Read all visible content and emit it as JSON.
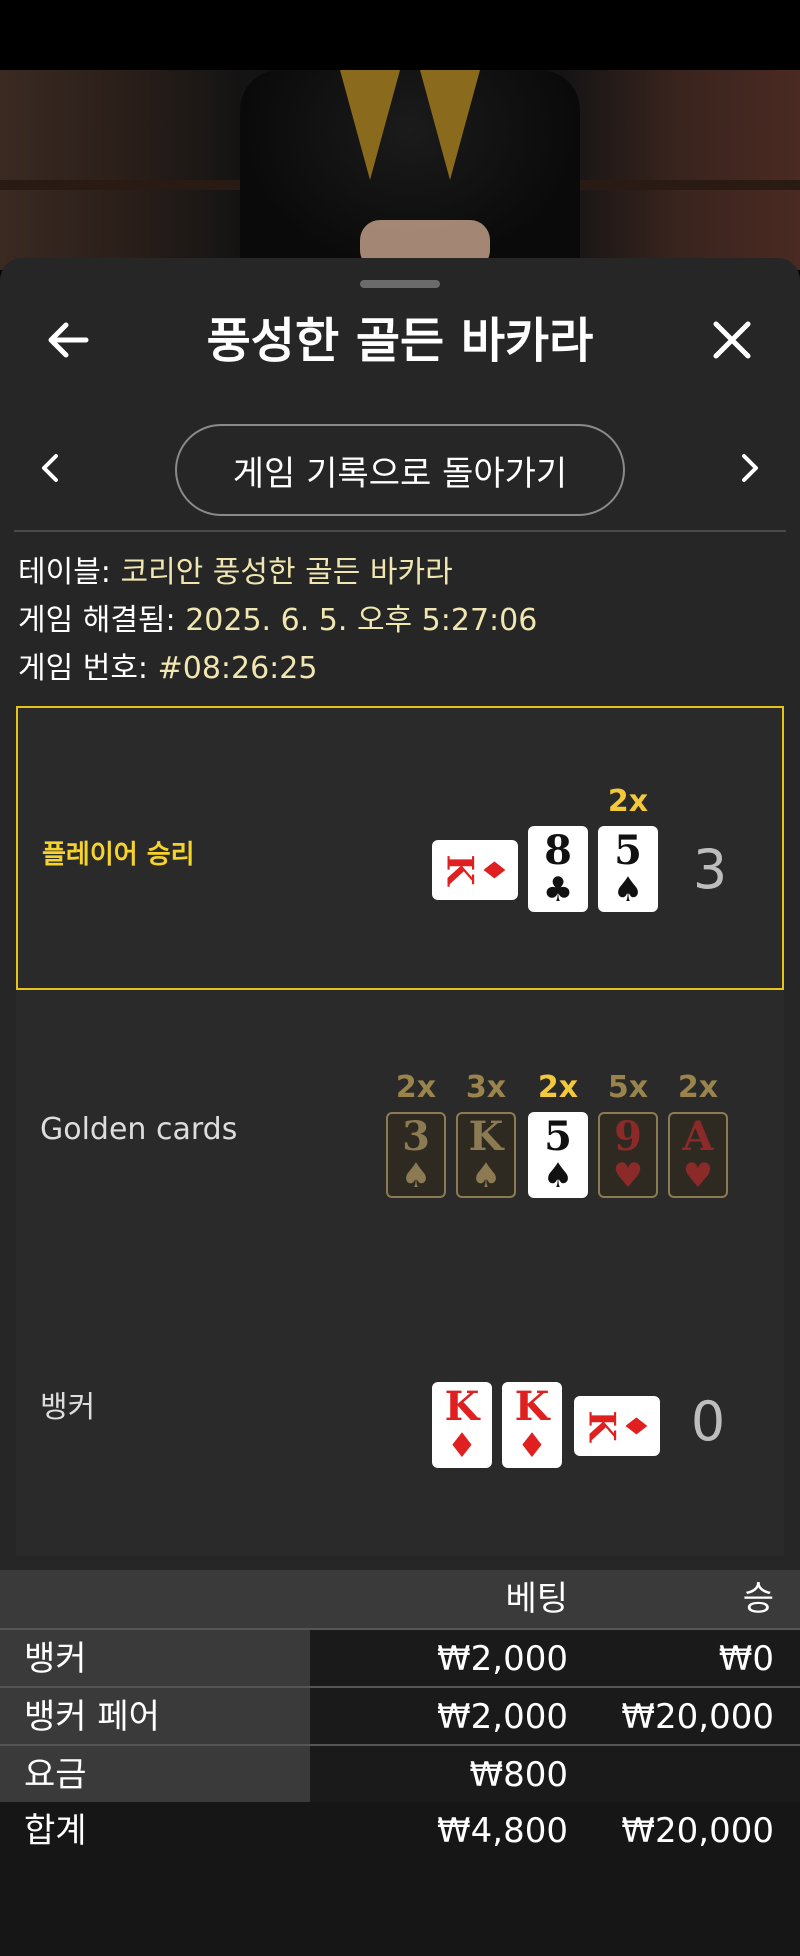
{
  "header": {
    "title": "풍성한 골든 바카라",
    "back_history": "게임 기록으로 돌아가기"
  },
  "meta": {
    "table_key": "테이블:",
    "table_value": "코리안 풍성한 골든 바카라",
    "resolved_key": "게임 해결됨:",
    "resolved_value": "2025. 6. 5. 오후 5:27:06",
    "number_key": "게임 번호:",
    "number_value": "#08:26:25"
  },
  "player": {
    "label": "플레이어 승리",
    "score": "3",
    "cards": [
      {
        "rank": "K",
        "suit": "♦",
        "color": "red",
        "sideways": true
      },
      {
        "rank": "8",
        "suit": "♣",
        "color": "black"
      },
      {
        "rank": "5",
        "suit": "♠",
        "color": "black",
        "multiplier": "2x"
      }
    ]
  },
  "golden": {
    "label": "Golden cards",
    "cards": [
      {
        "rank": "3",
        "suit": "♠",
        "color": "black",
        "multiplier": "2x",
        "active": false
      },
      {
        "rank": "K",
        "suit": "♠",
        "color": "black",
        "multiplier": "3x",
        "active": false
      },
      {
        "rank": "5",
        "suit": "♠",
        "color": "black",
        "multiplier": "2x",
        "active": true
      },
      {
        "rank": "9",
        "suit": "♥",
        "color": "red",
        "multiplier": "5x",
        "active": false
      },
      {
        "rank": "A",
        "suit": "♥",
        "color": "red",
        "multiplier": "2x",
        "active": false
      }
    ]
  },
  "banker": {
    "label": "뱅커",
    "score": "0",
    "cards": [
      {
        "rank": "K",
        "suit": "♦",
        "color": "red"
      },
      {
        "rank": "K",
        "suit": "♦",
        "color": "red"
      },
      {
        "rank": "K",
        "suit": "♦",
        "color": "red",
        "sideways": true
      }
    ]
  },
  "bets": {
    "col_bet": "베팅",
    "col_win": "승",
    "rows": [
      {
        "name": "뱅커",
        "bet": "₩2,000",
        "win": "₩0"
      },
      {
        "name": "뱅커 페어",
        "bet": "₩2,000",
        "win": "₩20,000"
      },
      {
        "name": "요금",
        "bet": "₩800",
        "win": ""
      }
    ],
    "total": {
      "name": "합계",
      "bet": "₩4,800",
      "win": "₩20,000"
    }
  },
  "colors": {
    "accent_gold": "#e6c21c",
    "value_text": "#f0e6b0",
    "multiplier": "#f3c83a"
  }
}
